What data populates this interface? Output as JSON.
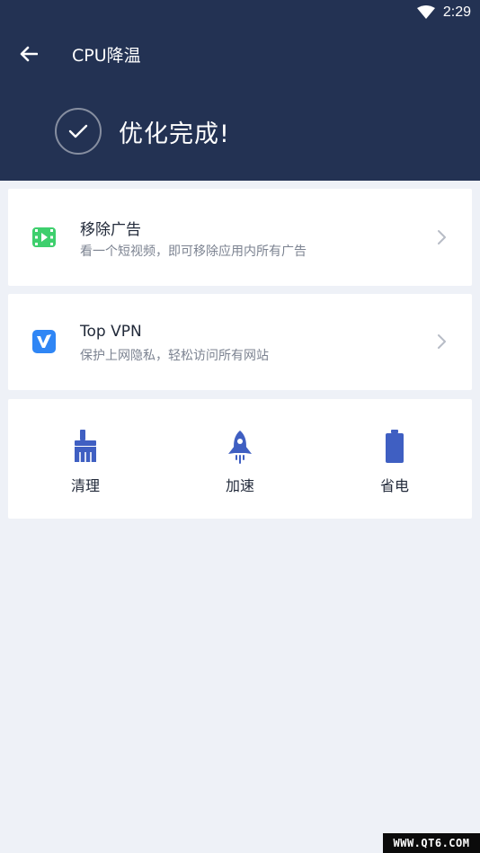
{
  "status_bar": {
    "time": "2:29",
    "wifi_icon": "wifi-icon"
  },
  "toolbar": {
    "back_icon": "arrow-left-icon",
    "title": "CPU降温"
  },
  "result": {
    "check_icon": "check-circle-icon",
    "title": "优化完成!"
  },
  "cards": [
    {
      "icon": "video-ad-icon",
      "icon_color": "#3ecf6d",
      "title": "移除广告",
      "subtitle": "看一个短视频，即可移除应用内所有广告"
    },
    {
      "icon": "vpn-icon",
      "icon_color": "#2f86f5",
      "title": "Top VPN",
      "subtitle": "保护上网隐私，轻松访问所有网站"
    }
  ],
  "actions": [
    {
      "icon": "broom-icon",
      "label": "清理"
    },
    {
      "icon": "rocket-icon",
      "label": "加速"
    },
    {
      "icon": "battery-icon",
      "label": "省电"
    }
  ],
  "colors": {
    "header_bg": "#233253",
    "page_bg": "#eef1f7",
    "action_icon": "#3f5fc2"
  },
  "watermark": "WWW.QT6.COM"
}
